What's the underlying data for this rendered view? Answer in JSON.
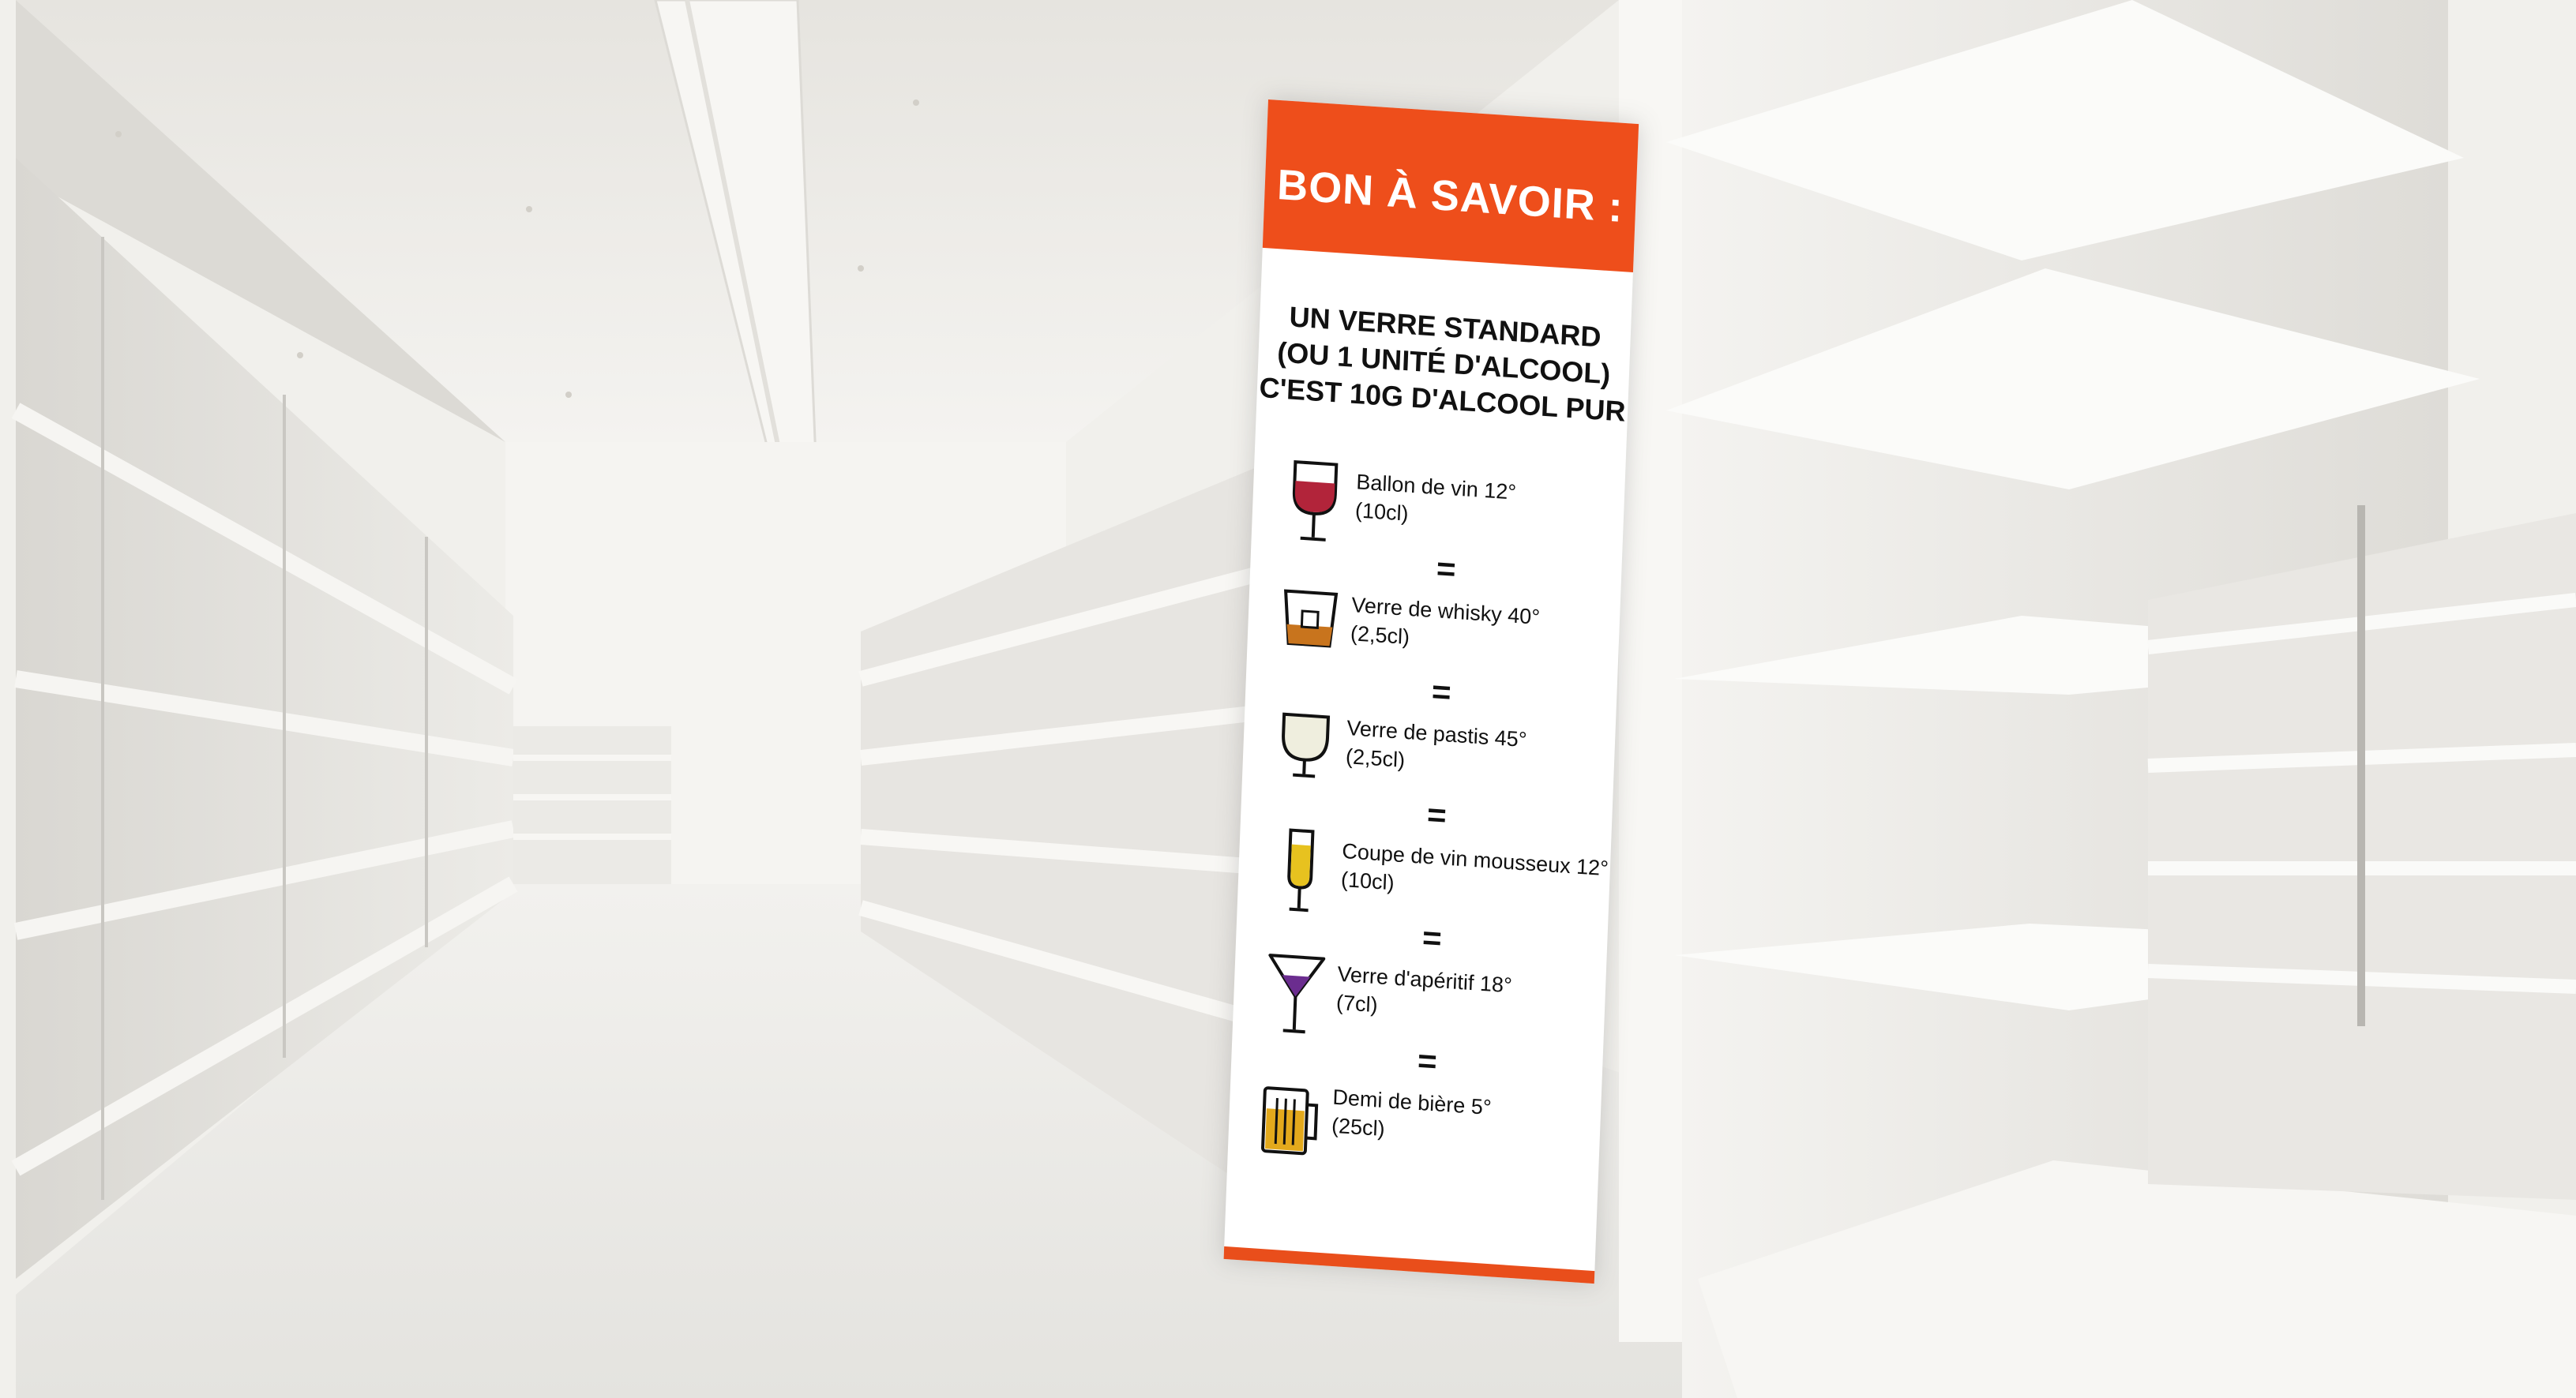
{
  "banner": {
    "title": "BON À SAVOIR :",
    "subtitle_lines": [
      "UN VERRE STANDARD",
      "(OU 1 UNITÉ D'ALCOOL)",
      "C'EST 10G D'ALCOOL PUR"
    ],
    "accent_color": "#ee4e1b",
    "equals": "=",
    "items": [
      {
        "icon": "wine-glass-icon",
        "label": "Ballon de vin 12°",
        "volume": "(10cl)"
      },
      {
        "icon": "whisky-glass-icon",
        "label": "Verre de whisky 40°",
        "volume": "(2,5cl)"
      },
      {
        "icon": "pastis-glass-icon",
        "label": "Verre de pastis 45°",
        "volume": "(2,5cl)"
      },
      {
        "icon": "champagne-flute-icon",
        "label": "Coupe de vin mousseux 12°",
        "volume": "(10cl)"
      },
      {
        "icon": "aperitif-glass-icon",
        "label": "Verre d'apéritif 18°",
        "volume": "(7cl)"
      },
      {
        "icon": "beer-mug-icon",
        "label": "Demi de bière 5°",
        "volume": "(25cl)"
      }
    ]
  }
}
